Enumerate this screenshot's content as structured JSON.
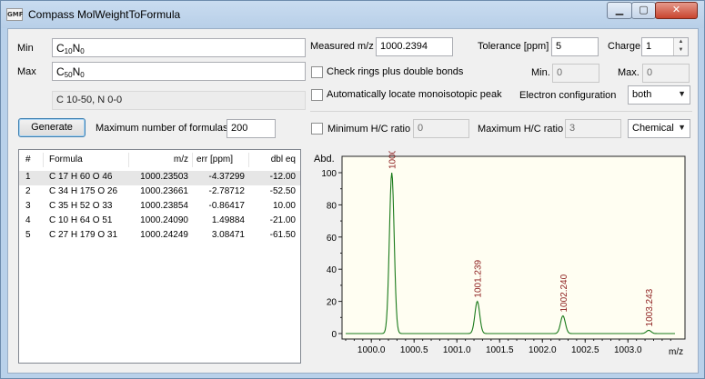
{
  "window": {
    "icon_text": "GMF",
    "title": "Compass MolWeightToFormula",
    "minimize_glyph": "▁",
    "maximize_glyph": "▢",
    "close_glyph": "✕"
  },
  "range": {
    "min_label": "Min",
    "min_c": "C",
    "min_c_sub": "10",
    "min_n": "N",
    "min_n_sub": "0",
    "max_label": "Max",
    "max_c": "C",
    "max_c_sub": "50",
    "max_n": "N",
    "max_n_sub": "0",
    "summary": "C 10-50, N 0-0"
  },
  "generate": {
    "button_label": "Generate",
    "max_formulas_label": "Maximum number of formulas",
    "max_formulas_value": "200"
  },
  "settings": {
    "measured_label": "Measured m/z",
    "measured_value": "1000.2394",
    "tolerance_label": "Tolerance [ppm]",
    "tolerance_value": "5",
    "charge_label": "Charge",
    "charge_value": "1",
    "rings_label": "Check rings plus double bonds",
    "rings_checked": false,
    "rings_min_label": "Min.",
    "rings_min_value": "0",
    "rings_max_label": "Max.",
    "rings_max_value": "0",
    "monoiso_label": "Automatically locate monoisotopic peak",
    "monoiso_checked": false,
    "electron_label": "Electron configuration",
    "electron_value": "both",
    "min_hc_label": "Minimum H/C ratio",
    "min_hc_checked": false,
    "min_hc_value": "0",
    "max_hc_label": "Maximum H/C ratio",
    "max_hc_value": "3",
    "hc_mode_value": "Chemical"
  },
  "results": {
    "columns": [
      "#",
      "Formula",
      "m/z",
      "err [ppm]",
      "dbl eq"
    ],
    "rows": [
      [
        "1",
        "C 17 H 60 O 46",
        "1000.23503",
        "-4.37299",
        "-12.00"
      ],
      [
        "2",
        "C 34 H 175 O 26",
        "1000.23661",
        "-2.78712",
        "-52.50"
      ],
      [
        "3",
        "C 35 H 52 O 33",
        "1000.23854",
        "-0.86417",
        "10.00"
      ],
      [
        "4",
        "C 10 H 64 O 51",
        "1000.24090",
        "1.49884",
        "-21.00"
      ],
      [
        "5",
        "C 27 H 179 O 31",
        "1000.24249",
        "3.08471",
        "-61.50"
      ]
    ]
  },
  "chart_data": {
    "type": "line",
    "ylabel": "Abd.",
    "xlabel": "m/z",
    "xlim": [
      999.7,
      1003.55
    ],
    "ylim": [
      0,
      110
    ],
    "xticks": [
      1000.0,
      1000.5,
      1001.0,
      1001.5,
      1002.0,
      1002.5,
      1003.0
    ],
    "yticks": [
      0,
      20,
      40,
      60,
      80,
      100
    ],
    "line_color": "#1a7a1a",
    "annotation_color": "#8b1a1a",
    "background": "#fffef2",
    "peaks": [
      {
        "x": 1000.239,
        "y": 100,
        "label": "1000"
      },
      {
        "x": 1001.239,
        "y": 20,
        "label": "1001.239"
      },
      {
        "x": 1002.24,
        "y": 11,
        "label": "1002.240"
      },
      {
        "x": 1003.243,
        "y": 2,
        "label": "1003.243"
      }
    ]
  }
}
